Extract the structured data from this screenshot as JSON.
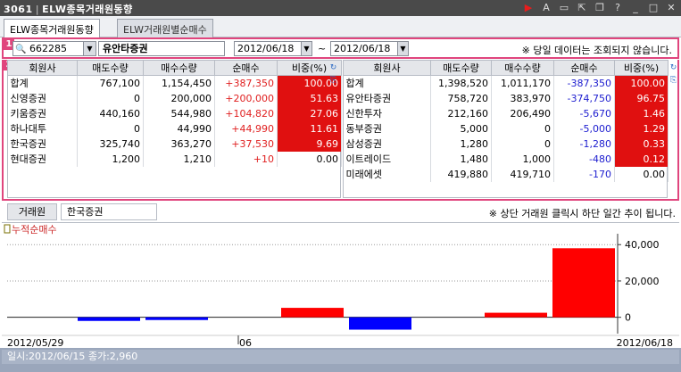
{
  "window": {
    "screen_no": "3061",
    "title": "ELW종목거래원동향"
  },
  "tabs": [
    {
      "label": "ELW종목거래원동향",
      "active": true
    },
    {
      "label": "ELW거래원별순매수",
      "active": false
    }
  ],
  "markers": {
    "query": "1",
    "table": "2"
  },
  "query": {
    "code": "662285",
    "name": "유안타증권",
    "date_from": "2012/06/18",
    "date_to": "2012/06/18",
    "separator": "~",
    "notice": "※ 당일 데이터는 조회되지 않습니다."
  },
  "table_headers": [
    "회원사",
    "매도수량",
    "매수수량",
    "순매수",
    "비중(%)"
  ],
  "sell_table": {
    "rows": [
      {
        "name": "합계",
        "sell": "767,100",
        "buy": "1,154,450",
        "net": "+387,350",
        "pct": "100.00",
        "net_color": "red",
        "pct_hl": true
      },
      {
        "name": "신영증권",
        "sell": "0",
        "buy": "200,000",
        "net": "+200,000",
        "pct": "51.63",
        "net_color": "red",
        "pct_hl": true
      },
      {
        "name": "키움증권",
        "sell": "440,160",
        "buy": "544,980",
        "net": "+104,820",
        "pct": "27.06",
        "net_color": "red",
        "pct_hl": true
      },
      {
        "name": "하나대투",
        "sell": "0",
        "buy": "44,990",
        "net": "+44,990",
        "pct": "11.61",
        "net_color": "red",
        "pct_hl": true
      },
      {
        "name": "한국증권",
        "sell": "325,740",
        "buy": "363,270",
        "net": "+37,530",
        "pct": "9.69",
        "net_color": "red",
        "pct_hl": true
      },
      {
        "name": "현대증권",
        "sell": "1,200",
        "buy": "1,210",
        "net": "+10",
        "pct": "0.00",
        "net_color": "red",
        "pct_hl": false
      }
    ]
  },
  "buy_table": {
    "rows": [
      {
        "name": "합계",
        "sell": "1,398,520",
        "buy": "1,011,170",
        "net": "-387,350",
        "pct": "100.00",
        "net_color": "blue",
        "pct_hl": true
      },
      {
        "name": "유안타증권",
        "sell": "758,720",
        "buy": "383,970",
        "net": "-374,750",
        "pct": "96.75",
        "net_color": "blue",
        "pct_hl": true
      },
      {
        "name": "신한투자",
        "sell": "212,160",
        "buy": "206,490",
        "net": "-5,670",
        "pct": "1.46",
        "net_color": "blue",
        "pct_hl": true
      },
      {
        "name": "동부증권",
        "sell": "5,000",
        "buy": "0",
        "net": "-5,000",
        "pct": "1.29",
        "net_color": "blue",
        "pct_hl": true
      },
      {
        "name": "삼성증권",
        "sell": "1,280",
        "buy": "0",
        "net": "-1,280",
        "pct": "0.33",
        "net_color": "blue",
        "pct_hl": true
      },
      {
        "name": "이트레이드",
        "sell": "1,480",
        "buy": "1,000",
        "net": "-480",
        "pct": "0.12",
        "net_color": "blue",
        "pct_hl": true
      },
      {
        "name": "미래에셋",
        "sell": "419,880",
        "buy": "419,710",
        "net": "-170",
        "pct": "0.00",
        "net_color": "blue",
        "pct_hl": false
      }
    ]
  },
  "broker": {
    "label": "거래원",
    "value": "한국증권",
    "notice": "※ 상단 거래원 클릭시 하단 일간 추이 됩니다."
  },
  "status_text": "일시:2012/06/15 종가:2,960",
  "colors": {
    "accent": "#e0457d",
    "positive": "#ff0000",
    "negative": "#0000ff"
  },
  "chart_data": {
    "type": "bar",
    "series": [
      {
        "name": "누적순매수",
        "values": [
          0,
          -2000,
          -1500,
          0,
          5200,
          -6800,
          0,
          2500,
          38000
        ]
      }
    ],
    "categories": [
      "2012/05/29",
      "",
      "",
      "06",
      "",
      "",
      "",
      "",
      "2012/06/18"
    ],
    "x_labels": [
      "2012/05/29",
      "06",
      "2012/06/18"
    ],
    "y_ticks": [
      "40,000",
      "20,000",
      "0"
    ],
    "ylim": [
      -9000,
      46000
    ],
    "grid": "horizontal dotted"
  }
}
